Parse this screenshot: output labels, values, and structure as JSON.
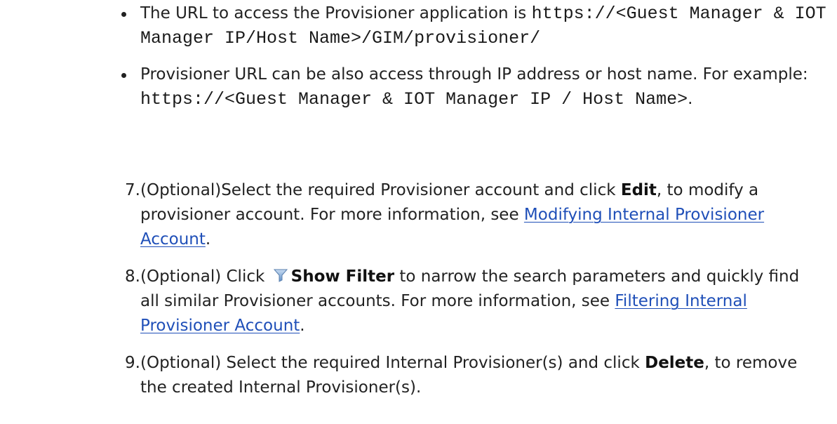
{
  "bullets": [
    {
      "text_before": "The URL to access the Provisioner application is ",
      "code": "https://<Guest Manager & IOT Manager IP/Host Name>/GIM/provisioner/"
    },
    {
      "text_before": "Provisioner URL can be also access through IP address or host name. For example: ",
      "code": "https://<Guest Manager & IOT Manager IP / Host Name>",
      "text_after": "."
    }
  ],
  "steps": [
    {
      "number": "7.",
      "text_1": "(Optional)Select the required Provisioner account and click ",
      "bold": "Edit",
      "text_2": ", to modify a provisioner account. For more information, see ",
      "link": "Modifying Internal Provisioner Account",
      "text_3": "."
    },
    {
      "number": "8.",
      "text_1": "(Optional) Click ",
      "icon": "filter-icon",
      "bold": "Show Filter",
      "text_2": " to narrow the search parameters and quickly find all similar Provisioner accounts. For more information, see ",
      "link": "Filtering Internal Provisioner Account",
      "text_3": "."
    },
    {
      "number": "9.",
      "text_1": "(Optional) Select the required Internal Provisioner(s) and click ",
      "bold": "Delete",
      "text_2": ", to remove the created Internal Provisioner(s)."
    }
  ],
  "colors": {
    "text": "#222222",
    "link": "#1f4fb8",
    "icon_funnel": "#7fa8d8"
  }
}
